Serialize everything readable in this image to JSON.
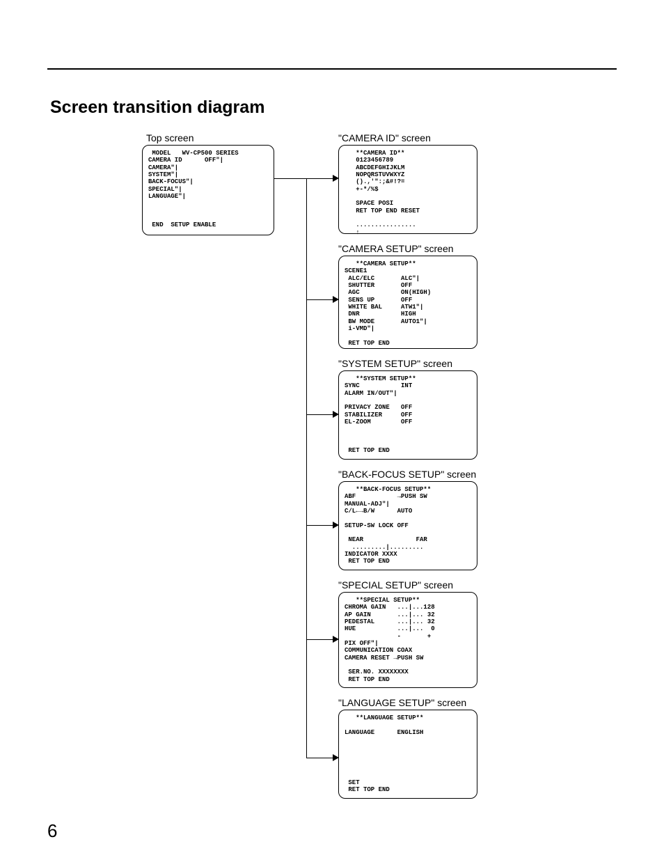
{
  "page_number": "6",
  "title": "Screen transition diagram",
  "labels": {
    "top": "Top screen",
    "camera_id": "\"CAMERA ID\" screen",
    "camera_setup": "\"CAMERA SETUP\" screen",
    "system_setup": "\"SYSTEM SETUP\" screen",
    "back_focus": "\"BACK-FOCUS SETUP\" screen",
    "special": "\"SPECIAL SETUP\" screen",
    "language": "\"LANGUAGE SETUP\" screen"
  },
  "screens": {
    "top": " MODEL   WV-CP500 SERIES\nCAMERA ID      OFF\"|\nCAMERA\"|\nSYSTEM\"|\nBACK-FOCUS\"|\nSPECIAL\"|\nLANGUAGE\"|\n\n\n\n END  SETUP ENABLE",
    "camera_id": "   **CAMERA ID**\n   0123456789\n   ABCDEFGHIJKLM\n   NOPQRSTUVWXYZ\n   ().,'\":;&#!?=\n   +-*/%$\n\n   SPACE POSI\n   RET TOP END RESET\n\n   ................\n   ↑",
    "camera_setup": "   **CAMERA SETUP**\nSCENE1\n ALC/ELC       ALC\"|\n SHUTTER       OFF\n AGC           ON(HIGH)\n SENS UP       OFF\n WHITE BAL     ATW1\"|\n DNR           HIGH\n BW MODE       AUTO1\"|\n i-VMD\"|\n\n RET TOP END",
    "system_setup": "   **SYSTEM SETUP**\nSYNC           INT\nALARM IN/OUT\"|\n\nPRIVACY ZONE   OFF\nSTABILIZER     OFF\nEL-ZOOM        OFF\n\n\n\n RET TOP END",
    "back_focus": "   **BACK-FOCUS SETUP**\nABF           →PUSH SW\nMANUAL-ADJ\"|\nC/L←→B/W      AUTO\n\nSETUP-SW LOCK OFF\n\n NEAR              FAR\n  .........|.........\nINDICATOR XXXX\n RET TOP END",
    "special": "   **SPECIAL SETUP**\nCHROMA GAIN   ...|...128\nAP GAIN       ...|... 32\nPEDESTAL      ...|... 32\nHUE           ...|...  0\n              -       +\nPIX OFF\"|\nCOMMUNICATION COAX\nCAMERA RESET →PUSH SW\n\n SER.NO. XXXXXXXX\n RET TOP END",
    "language": "   **LANGUAGE SETUP**\n\nLANGUAGE      ENGLISH\n\n\n\n\n\n\n SET\n RET TOP END"
  }
}
